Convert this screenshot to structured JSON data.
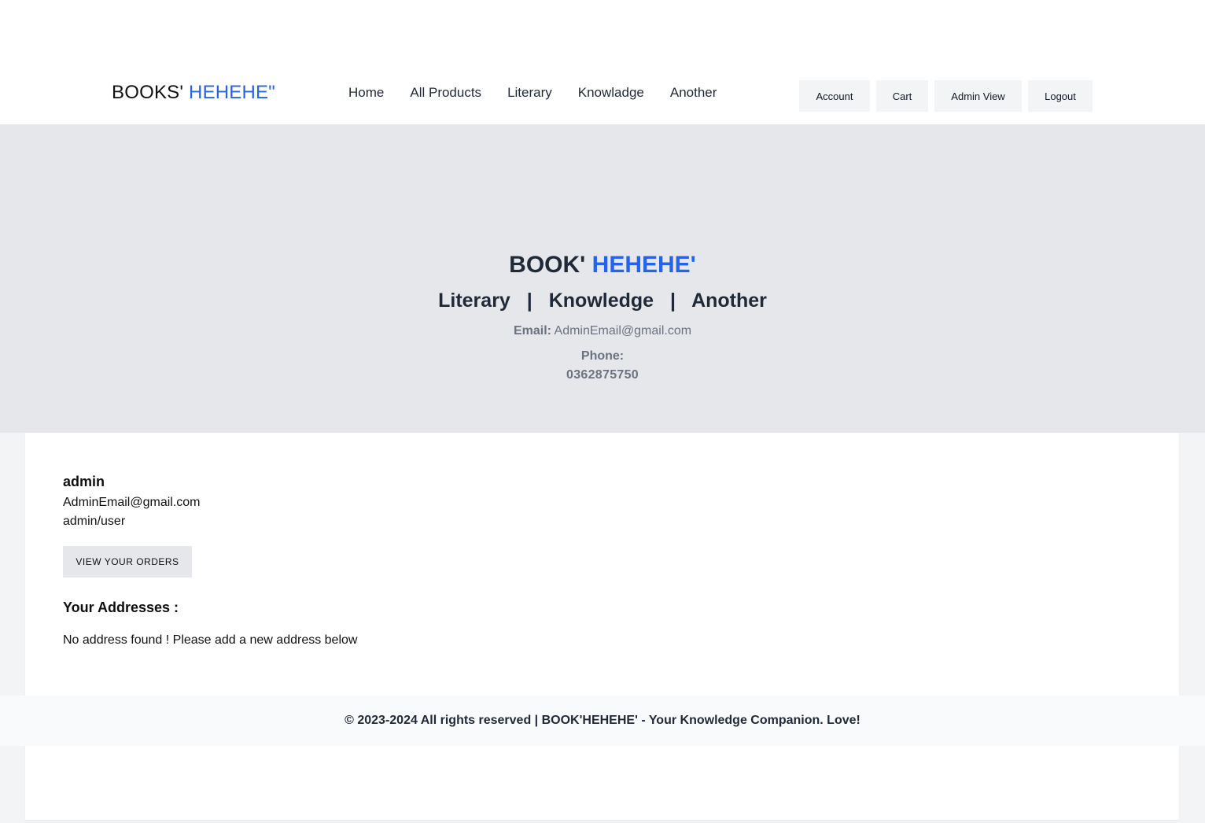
{
  "header": {
    "brand_main": "BOOKS'",
    "brand_accent": "HEHEHE\"",
    "nav": [
      "Home",
      "All Products",
      "Literary",
      "Knowladge",
      "Another"
    ],
    "actions": {
      "account": "Account",
      "cart": "Cart",
      "admin_view": "Admin View",
      "logout": "Logout"
    }
  },
  "hero": {
    "title_main": "BOOK'",
    "title_accent": "HEHEHE'",
    "categories": [
      "Literary",
      "Knowledge",
      "Another"
    ],
    "separator": "|",
    "email_label": "Email:",
    "email_value": "AdminEmail@gmail.com",
    "phone_label": "Phone:",
    "phone_value": "0362875750"
  },
  "account": {
    "name": "admin",
    "email": "AdminEmail@gmail.com",
    "role": "admin/user",
    "orders_button": "VIEW YOUR ORDERS",
    "addresses_title": "Your Addresses :",
    "no_address_text": "No address found ! Please add a new address below"
  },
  "footer": {
    "text": "© 2023-2024 All rights reserved | BOOK'HEHEHE' - Your Knowledge Companion. Love!"
  },
  "colors": {
    "accent": "#2563eb",
    "hero_bg": "#e5e7eb",
    "button_bg": "#f3f4f6"
  }
}
